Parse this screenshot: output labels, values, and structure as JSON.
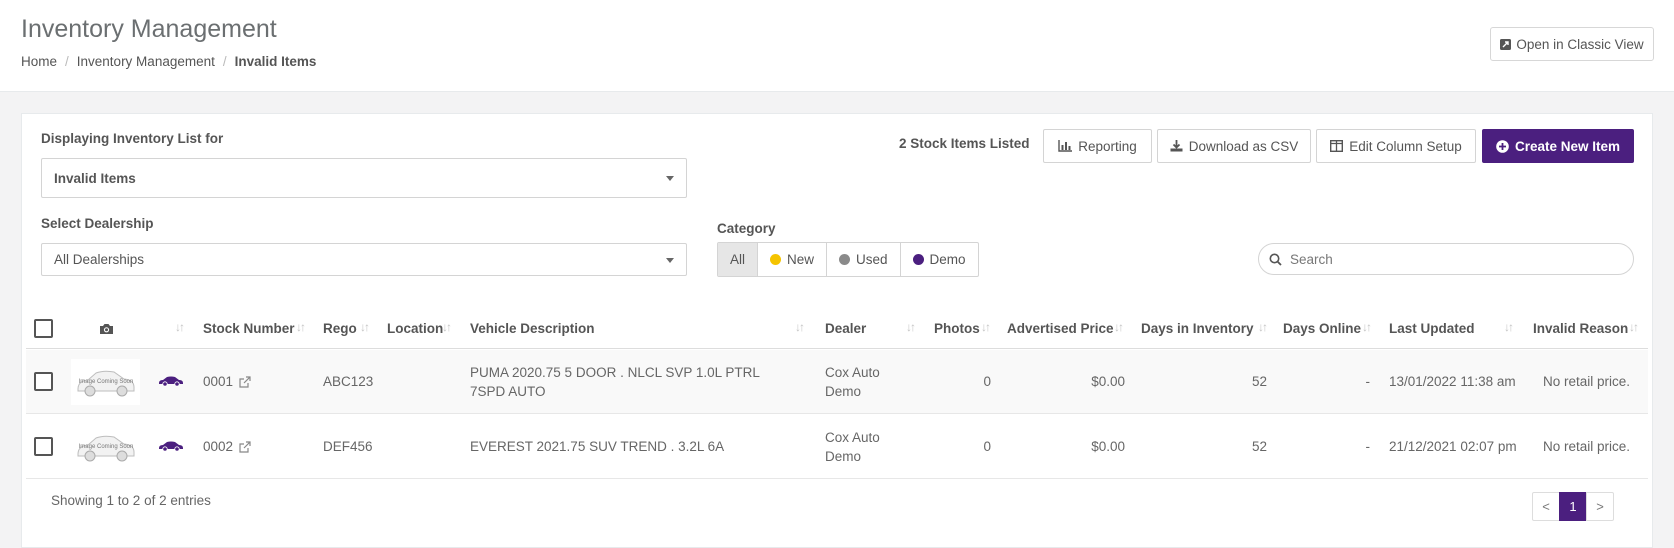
{
  "header": {
    "title": "Inventory Management",
    "breadcrumb": [
      "Home",
      "Inventory Management",
      "Invalid Items"
    ],
    "classic_view_label": "Open in Classic View"
  },
  "filters": {
    "inventory_list_label": "Displaying Inventory List for",
    "inventory_list_value": "Invalid Items",
    "dealership_label": "Select Dealership",
    "dealership_value": "All Dealerships",
    "category_label": "Category",
    "categories": [
      {
        "label": "All",
        "color": null,
        "active": true
      },
      {
        "label": "New",
        "color": "#f5c400"
      },
      {
        "label": "Used",
        "color": "#8a8a8a"
      },
      {
        "label": "Demo",
        "color": "#4b1f7f"
      }
    ],
    "search_placeholder": "Search"
  },
  "toolbar": {
    "stock_count": "2 Stock Items Listed",
    "reporting_label": "Reporting",
    "download_label": "Download as CSV",
    "edit_columns_label": "Edit Column Setup",
    "create_label": "Create New Item"
  },
  "table": {
    "columns": [
      "Stock Number",
      "Rego",
      "Location",
      "Vehicle Description",
      "Dealer",
      "Photos",
      "Advertised Price",
      "Days in Inventory",
      "Days Online",
      "Last Updated",
      "Invalid Reason"
    ],
    "rows": [
      {
        "stock_number": "0001",
        "rego": "ABC123",
        "location": "",
        "description": "PUMA 2020.75 5 DOOR . NLCL SVP 1.0L PTRL 7SPD AUTO",
        "dealer": "Cox Auto Demo",
        "photos": "0",
        "price": "$0.00",
        "days_inventory": "52",
        "days_online": "-",
        "last_updated": "13/01/2022 11:38 am",
        "invalid_reason": "No retail price."
      },
      {
        "stock_number": "0002",
        "rego": "DEF456",
        "location": "",
        "description": "EVEREST 2021.75 SUV TREND . 3.2L 6A",
        "dealer": "Cox Auto Demo",
        "photos": "0",
        "price": "$0.00",
        "days_inventory": "52",
        "days_online": "-",
        "last_updated": "21/12/2021 02:07 pm",
        "invalid_reason": "No retail price."
      }
    ],
    "thumb_caption": "Image Coming Soon",
    "footer": "Showing 1 to 2 of 2 entries"
  },
  "pagination": {
    "prev": "<",
    "page": "1",
    "next": ">"
  },
  "colors": {
    "brand": "#4b1f7f",
    "new": "#f5c400",
    "used": "#8a8a8a",
    "demo": "#4b1f7f"
  }
}
